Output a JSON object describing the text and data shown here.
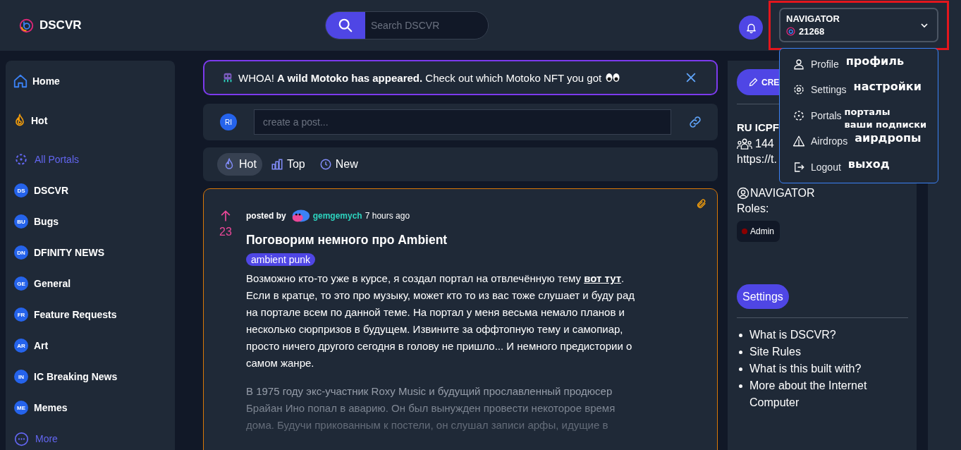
{
  "header": {
    "logo": "DSCVR",
    "search": {
      "placeholder": "Search DSCVR"
    },
    "account": {
      "name": "NAVIGATOR",
      "points": "21268",
      "highlighted": true
    }
  },
  "account_menu": {
    "items": [
      {
        "kind": "profile",
        "label": "Profile",
        "note": [
          "профиль"
        ]
      },
      {
        "kind": "settings",
        "label": "Settings",
        "note": [
          "настройки"
        ]
      },
      {
        "kind": "portals",
        "label": "Portals",
        "note": [
          "порталы",
          "ваши подписки"
        ]
      },
      {
        "kind": "airdrops",
        "label": "Airdrops",
        "note": [
          "аирдропы"
        ]
      },
      {
        "kind": "logout",
        "label": "Logout",
        "note": [
          "выход"
        ]
      }
    ]
  },
  "sidebar": {
    "items": [
      {
        "kind": "home",
        "label": "Home"
      },
      {
        "kind": "hot",
        "label": "Hot"
      },
      {
        "kind": "all",
        "label": "All Portals"
      },
      {
        "kind": "portal",
        "initials": "DS",
        "label": "DSCVR"
      },
      {
        "kind": "portal",
        "initials": "BU",
        "label": "Bugs"
      },
      {
        "kind": "portal",
        "initials": "DN",
        "label": "DFINITY NEWS"
      },
      {
        "kind": "portal",
        "initials": "GE",
        "label": "General"
      },
      {
        "kind": "portal",
        "initials": "FR",
        "label": "Feature Requests"
      },
      {
        "kind": "portal",
        "initials": "AR",
        "label": "Art"
      },
      {
        "kind": "portal",
        "initials": "IN",
        "label": "IC Breaking News"
      },
      {
        "kind": "portal",
        "initials": "ME",
        "label": "Memes"
      },
      {
        "kind": "more",
        "label": "More"
      }
    ]
  },
  "banner": {
    "text": "WHOA! **A wild Motoko has appeared.** Check out which Motoko NFT you got"
  },
  "composer": {
    "avatar": "RI",
    "placeholder": "create a post..."
  },
  "sort_tabs": [
    {
      "kind": "hot",
      "label": "Hot",
      "selected": true
    },
    {
      "kind": "top",
      "label": "Top",
      "selected": false
    },
    {
      "kind": "new",
      "label": "New",
      "selected": false
    }
  ],
  "post": {
    "votes": "23",
    "posted_by": "posted by",
    "author": "gemgemych",
    "time": "7 hours ago",
    "title": "Поговорим немного про Ambient",
    "tag": "ambient punk",
    "body_before": "Возможно кто-то уже в курсе, я создал портал на отвлечённую тему",
    "body_link": "вот тут",
    "body_after": ". Если в кратце, то это про музыку, может кто то из вас тоже слушает и буду рад на портале всем по данной теме. На портал у меня весьма немало планов и несколько сюрпризов в будущем. Извините за оффтопную тему и самопиар, просто ничего другого сегодня в голову не пришло... И немного предистории о самом жанре.",
    "faded_text": "В 1975 году экс-участник Roxy Music и будущий прославленный продюсер Брайан Ино попал в аварию. Он был вынужден провести некоторое время дома. Будучи прикованным к постели, он слушал записи арфы, идущие в"
  },
  "portal_panel": {
    "create_button": "CRE",
    "name": "RU ICPF",
    "members": "144",
    "link": "https://t.",
    "owner": "NAVIGATOR",
    "roles_label": "Roles:",
    "roles": [
      {
        "label": "Admin",
        "color": "#8b0000"
      }
    ],
    "settings_button": "Settings",
    "links": [
      "What is DSCVR?",
      "Site Rules",
      "What is this built with?",
      "More about the Internet Computer"
    ]
  }
}
